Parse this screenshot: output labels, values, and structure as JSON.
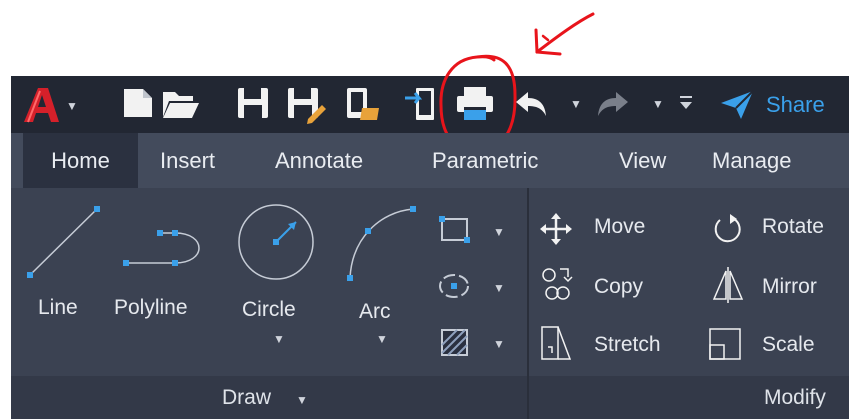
{
  "quick_access": {
    "app_menu_icon": "autocad-a-logo",
    "share_label": "Share",
    "icons": [
      "new-file-icon",
      "open-folder-icon",
      "save-icon",
      "save-as-icon",
      "publish-web-icon",
      "import-icon",
      "plot-icon",
      "undo-icon",
      "redo-icon",
      "customize-icon",
      "share-icon"
    ]
  },
  "annotation": {
    "circle_color": "#e8141b",
    "arrow_color": "#e8141b"
  },
  "tabs": [
    "Home",
    "Insert",
    "Annotate",
    "Parametric",
    "View",
    "Manage"
  ],
  "active_tab": "Home",
  "draw_panel": {
    "tools": {
      "line": "Line",
      "polyline": "Polyline",
      "circle": "Circle",
      "arc": "Arc"
    },
    "footer": "Draw"
  },
  "modify_panel": {
    "tools": {
      "move": "Move",
      "rotate": "Rotate",
      "copy": "Copy",
      "mirror": "Mirror",
      "stretch": "Stretch",
      "scale": "Scale"
    },
    "footer": "Modify"
  },
  "colors": {
    "toolbar_bg": "#222733",
    "ribbon_bg": "#3b4252",
    "accent_blue": "#3aa0ea",
    "logo_red": "#d5202a"
  }
}
